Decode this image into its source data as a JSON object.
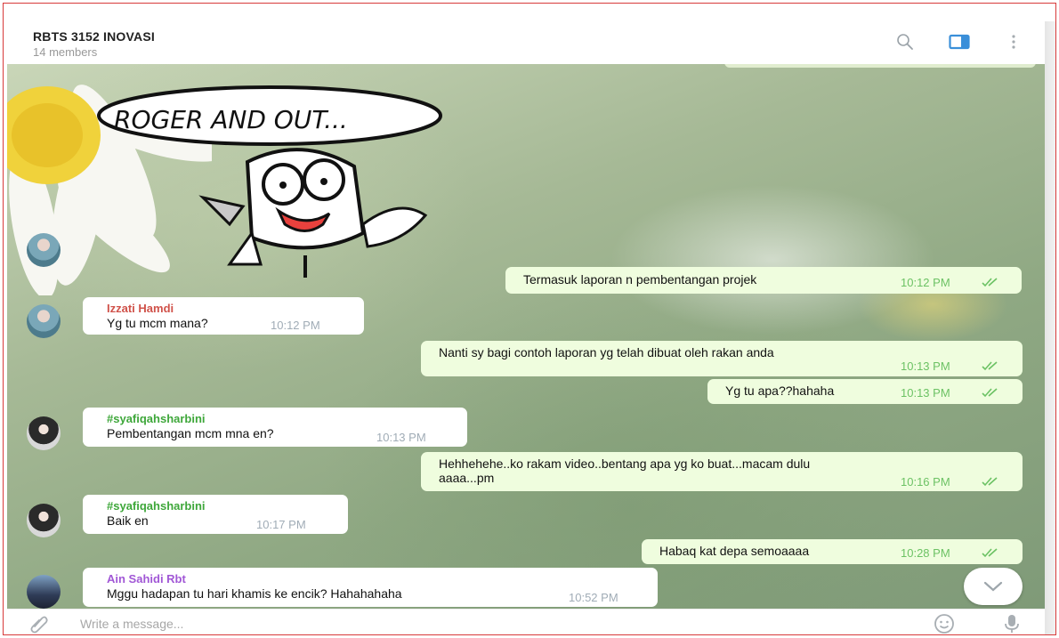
{
  "header": {
    "title": "RBTS 3152 INOVASI",
    "subtitle": "14 members"
  },
  "sticker": {
    "caption": "ROGER AND OUT..."
  },
  "messages": [
    {
      "dir": "out",
      "text": "Termasuk laporan n pembentangan projek",
      "time": "10:12 PM"
    },
    {
      "dir": "in",
      "sender": "Izzati Hamdi",
      "sender_color": "#d0524a",
      "text": "Yg tu mcm mana?",
      "time": "10:12 PM"
    },
    {
      "dir": "out",
      "text": "Nanti sy bagi contoh laporan yg telah dibuat oleh rakan anda",
      "time": "10:13 PM"
    },
    {
      "dir": "out",
      "text": "Yg tu apa??hahaha",
      "time": "10:13 PM"
    },
    {
      "dir": "in",
      "sender": "#syafiqahsharbini",
      "sender_color": "#3ea73a",
      "text": "Pembentangan mcm mna en?",
      "time": "10:13 PM"
    },
    {
      "dir": "out",
      "text_line1": "Hehhehehe..ko rakam video..bentang apa yg ko buat...macam dulu",
      "text_line2": "aaaa...pm",
      "time": "10:16 PM"
    },
    {
      "dir": "in",
      "sender": "#syafiqahsharbini",
      "sender_color": "#3ea73a",
      "text": "Baik en",
      "time": "10:17 PM"
    },
    {
      "dir": "out",
      "text": "Habaq kat depa semoaaaa",
      "time": "10:28 PM"
    },
    {
      "dir": "in",
      "sender": "Ain Sahidi Rbt",
      "sender_color": "#a157d6",
      "text": "Mggu hadapan tu hari khamis ke encik? Hahahahaha",
      "time": "10:52 PM"
    }
  ],
  "composer": {
    "placeholder": "Write a message..."
  },
  "colors": {
    "outgoing_bubble": "#effdde",
    "incoming_bubble": "#ffffff",
    "read_ticks": "#6cc264",
    "header_accent": "#3a8fd9"
  },
  "icons": [
    "search-icon",
    "sidebar-toggle-icon",
    "more-icon",
    "attach-icon",
    "emoji-icon",
    "mic-icon",
    "chevron-down-icon"
  ]
}
